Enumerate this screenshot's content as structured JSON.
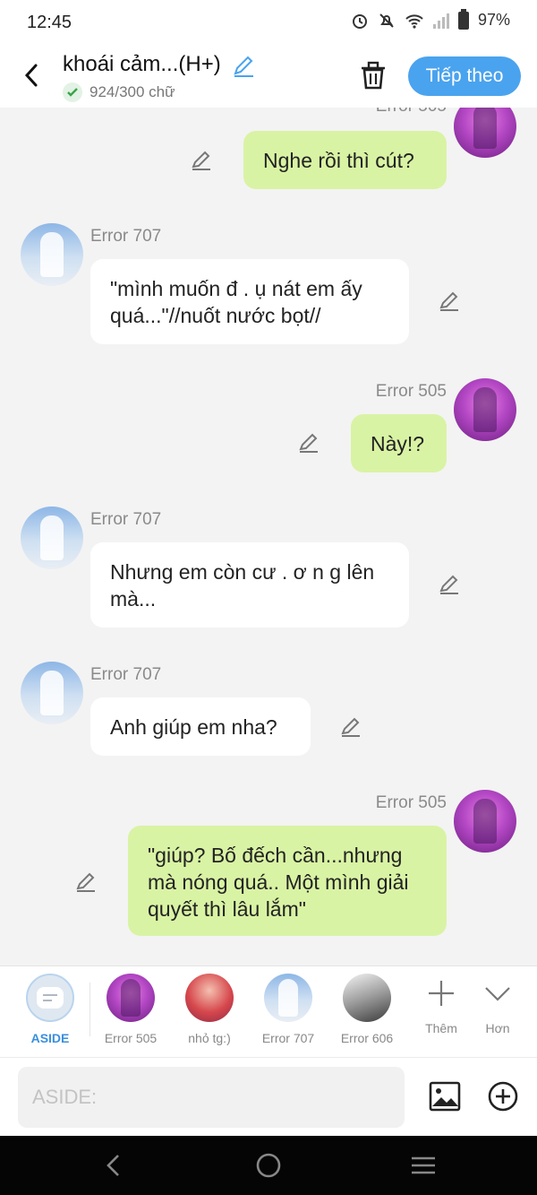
{
  "status_bar": {
    "time": "12:45",
    "battery": "97%"
  },
  "header": {
    "title": "khoái cảm...(H+)",
    "word_count": "924/300 chữ",
    "next_label": "Tiếp theo"
  },
  "messages": [
    {
      "sender": "Error 505",
      "text": "Nghe rồi thì cút?",
      "side": "right"
    },
    {
      "sender": "Error 707",
      "text": "\"mình muốn đ . ụ nát em ấy quá...\"//nuốt nước bọt//",
      "side": "left"
    },
    {
      "sender": "Error 505",
      "text": "Này!?",
      "side": "right"
    },
    {
      "sender": "Error 707",
      "text": "Nhưng em còn cư . ơ n g lên mà...",
      "side": "left"
    },
    {
      "sender": "Error 707",
      "text": "Anh giúp em nha?",
      "side": "left"
    },
    {
      "sender": "Error 505",
      "text": "\"giúp? Bố đếch cần...nhưng mà nóng quá.. Một mình giải quyết thì lâu lắm\"",
      "side": "right"
    }
  ],
  "characters": [
    {
      "label": "ASIDE"
    },
    {
      "label": "Error 505"
    },
    {
      "label": "nhỏ tg:)"
    },
    {
      "label": "Error 707"
    },
    {
      "label": "Error 606"
    }
  ],
  "more_label": "Thêm",
  "collapse_label": "Hơn",
  "input": {
    "placeholder": "ASIDE:"
  },
  "colors": {
    "accent": "#4aa3ee",
    "outgoing_bubble": "#d9f3a4",
    "incoming_bubble": "#ffffff",
    "background": "#f3f3f3"
  },
  "icons": [
    "back-arrow-icon",
    "pencil-icon",
    "check-icon",
    "trash-icon",
    "image-icon",
    "plus-circle-icon",
    "plus-icon",
    "chevron-down-icon"
  ]
}
